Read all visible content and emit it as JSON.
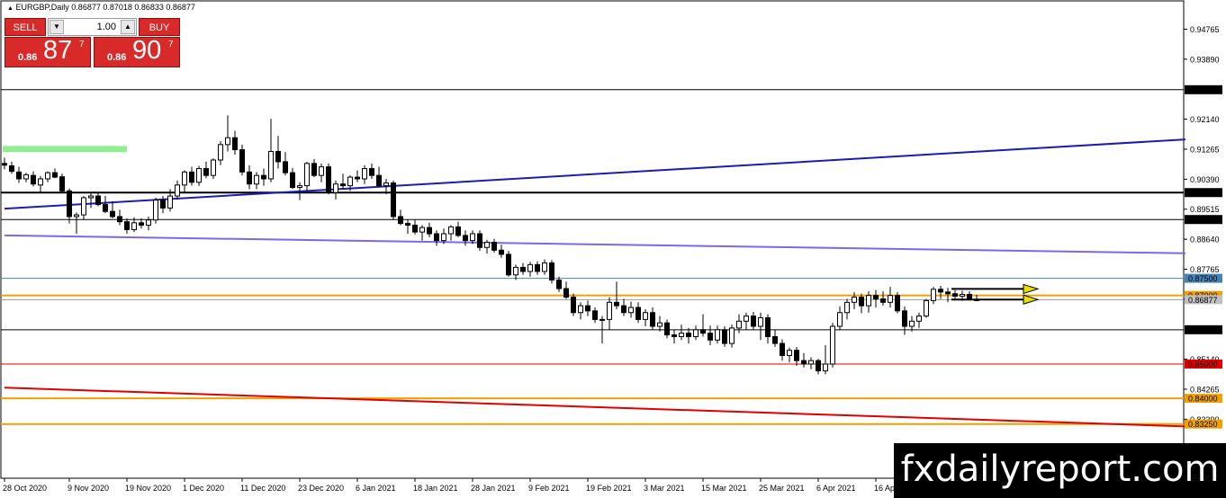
{
  "header": {
    "title": "EURGBP,Daily  0.86877 0.87018 0.86833 0.86877"
  },
  "trade_panel": {
    "sell_label": "SELL",
    "buy_label": "BUY",
    "lot_value": "1.00",
    "sell_price": {
      "small": "0.86",
      "big": "87",
      "sup": "7"
    },
    "buy_price": {
      "small": "0.86",
      "big": "90",
      "sup": "7"
    },
    "button_color": "#d92a2a"
  },
  "watermark": "fxdailyreport.com",
  "chart_data": {
    "type": "candlestick",
    "symbol": "EURGBP",
    "timeframe": "Daily",
    "ohlc_header": [
      0.86877,
      0.87018,
      0.86833,
      0.86877
    ],
    "ylim": [
      0.8167,
      0.9559
    ],
    "y_ticks": [
      "0.94765",
      "0.93890",
      "0.92140",
      "0.91265",
      "0.90390",
      "0.89515",
      "0.88640",
      "0.87765",
      "0.86890",
      "0.85140",
      "0.84265",
      "0.83390"
    ],
    "x_ticks": [
      "28 Oct 2020",
      "9 Nov 2020",
      "19 Nov 2020",
      "1 Dec 2020",
      "11 Dec 2020",
      "23 Dec 2020",
      "6 Jan 2021",
      "18 Jan 2021",
      "28 Jan 2021",
      "9 Feb 2021",
      "19 Feb 2021",
      "3 Mar 2021",
      "15 Mar 2021",
      "25 Mar 2021",
      "6 Apr 2021",
      "16 Apr"
    ],
    "x_tick_index": [
      0,
      9,
      17,
      25,
      33,
      41,
      49,
      57,
      65,
      73,
      81,
      89,
      97,
      105,
      113,
      121
    ],
    "horizontal_levels": [
      {
        "value": 0.93,
        "label": "0.93000",
        "color": "#000000"
      },
      {
        "value": 0.9,
        "label": "0.90000",
        "color": "#000000"
      },
      {
        "value": 0.89214,
        "label": "0.89214",
        "color": "#000000"
      },
      {
        "value": 0.875,
        "label": "0.87500",
        "color": "#4682b4"
      },
      {
        "value": 0.87,
        "label": "0.87000",
        "color": "#f0a000"
      },
      {
        "value": 0.86877,
        "label": "0.86877",
        "color": "#999999"
      },
      {
        "value": 0.86,
        "label": "0.86000",
        "color": "#000000"
      },
      {
        "value": 0.85,
        "label": "0.85000",
        "color": "#e00000"
      },
      {
        "value": 0.84,
        "label": "0.84000",
        "color": "#f0a000"
      },
      {
        "value": 0.8325,
        "label": "0.83250",
        "color": "#f0a000"
      }
    ],
    "trendlines": [
      {
        "color": "#1c1cb4",
        "start": [
          0,
          0.8953
        ],
        "end": [
          164,
          0.9155
        ]
      },
      {
        "color": "#7b68ee",
        "start": [
          0,
          0.8875
        ],
        "end": [
          164,
          0.8823
        ]
      },
      {
        "color": "#e00000",
        "start": [
          0,
          0.8431
        ],
        "end": [
          164,
          0.8318
        ]
      }
    ],
    "arrows": [
      {
        "color": "#e8e000",
        "start": [
          131.5,
          0.8719
        ],
        "end": [
          143.5,
          0.8719
        ]
      },
      {
        "color": "#e8e000",
        "start": [
          131.5,
          0.8688
        ],
        "end": [
          143.5,
          0.8688
        ]
      }
    ],
    "zone": {
      "color": "#90ee90",
      "x": [
        0,
        17
      ],
      "y": [
        0.9118,
        0.9136
      ]
    },
    "candles": [
      [
        0.9085,
        0.9102,
        0.9068,
        0.908
      ],
      [
        0.9078,
        0.909,
        0.9055,
        0.9062
      ],
      [
        0.906,
        0.9075,
        0.9028,
        0.904
      ],
      [
        0.904,
        0.9058,
        0.903,
        0.9052
      ],
      [
        0.905,
        0.9062,
        0.9018,
        0.9025
      ],
      [
        0.9022,
        0.9048,
        0.8998,
        0.904
      ],
      [
        0.904,
        0.9062,
        0.903,
        0.9058
      ],
      [
        0.9058,
        0.907,
        0.9042,
        0.9045
      ],
      [
        0.9046,
        0.9055,
        0.9,
        0.9005
      ],
      [
        0.9005,
        0.9012,
        0.891,
        0.893
      ],
      [
        0.893,
        0.8942,
        0.888,
        0.8935
      ],
      [
        0.8935,
        0.899,
        0.892,
        0.8985
      ],
      [
        0.8985,
        0.9,
        0.8955,
        0.899
      ],
      [
        0.899,
        0.9,
        0.896,
        0.8965
      ],
      [
        0.8965,
        0.899,
        0.894,
        0.8945
      ],
      [
        0.8945,
        0.8975,
        0.8925,
        0.893
      ],
      [
        0.893,
        0.895,
        0.8905,
        0.8915
      ],
      [
        0.8915,
        0.8925,
        0.888,
        0.8892
      ],
      [
        0.8892,
        0.8928,
        0.8885,
        0.8912
      ],
      [
        0.8912,
        0.8925,
        0.8895,
        0.8905
      ],
      [
        0.8905,
        0.893,
        0.889,
        0.892
      ],
      [
        0.892,
        0.8985,
        0.891,
        0.8978
      ],
      [
        0.8978,
        0.899,
        0.894,
        0.8955
      ],
      [
        0.8955,
        0.901,
        0.8945,
        0.899
      ],
      [
        0.899,
        0.9035,
        0.898,
        0.9022
      ],
      [
        0.9022,
        0.9065,
        0.9,
        0.906
      ],
      [
        0.906,
        0.9075,
        0.902,
        0.903
      ],
      [
        0.903,
        0.9078,
        0.902,
        0.907
      ],
      [
        0.907,
        0.909,
        0.9042,
        0.905
      ],
      [
        0.905,
        0.91,
        0.904,
        0.9095
      ],
      [
        0.9095,
        0.915,
        0.908,
        0.914
      ],
      [
        0.914,
        0.9225,
        0.912,
        0.916
      ],
      [
        0.916,
        0.918,
        0.911,
        0.9125
      ],
      [
        0.9125,
        0.914,
        0.905,
        0.906
      ],
      [
        0.906,
        0.908,
        0.901,
        0.9025
      ],
      [
        0.9025,
        0.906,
        0.901,
        0.905
      ],
      [
        0.905,
        0.907,
        0.902,
        0.904
      ],
      [
        0.904,
        0.9215,
        0.903,
        0.912
      ],
      [
        0.912,
        0.9165,
        0.907,
        0.909
      ],
      [
        0.909,
        0.9118,
        0.905,
        0.9058
      ],
      [
        0.9058,
        0.9072,
        0.901,
        0.9015
      ],
      [
        0.9015,
        0.903,
        0.8978,
        0.902
      ],
      [
        0.902,
        0.909,
        0.9005,
        0.9085
      ],
      [
        0.9085,
        0.9098,
        0.9045,
        0.905
      ],
      [
        0.905,
        0.9085,
        0.903,
        0.9075
      ],
      [
        0.9075,
        0.9085,
        0.8995,
        0.9
      ],
      [
        0.9,
        0.9035,
        0.898,
        0.9025
      ],
      [
        0.9025,
        0.9055,
        0.901,
        0.902
      ],
      [
        0.902,
        0.905,
        0.9005,
        0.9045
      ],
      [
        0.9045,
        0.9065,
        0.903,
        0.904
      ],
      [
        0.904,
        0.908,
        0.9025,
        0.907
      ],
      [
        0.907,
        0.9085,
        0.904,
        0.905
      ],
      [
        0.905,
        0.9075,
        0.9015,
        0.902
      ],
      [
        0.902,
        0.904,
        0.8995,
        0.9028
      ],
      [
        0.9028,
        0.9035,
        0.892,
        0.893
      ],
      [
        0.893,
        0.895,
        0.8905,
        0.891
      ],
      [
        0.891,
        0.8922,
        0.888,
        0.8905
      ],
      [
        0.8905,
        0.892,
        0.8878,
        0.8885
      ],
      [
        0.8885,
        0.8905,
        0.886,
        0.8898
      ],
      [
        0.8898,
        0.8912,
        0.887,
        0.888
      ],
      [
        0.888,
        0.889,
        0.8845,
        0.886
      ],
      [
        0.886,
        0.8895,
        0.885,
        0.888
      ],
      [
        0.888,
        0.8905,
        0.886,
        0.89
      ],
      [
        0.89,
        0.8915,
        0.887,
        0.8875
      ],
      [
        0.8875,
        0.889,
        0.8845,
        0.886
      ],
      [
        0.886,
        0.889,
        0.885,
        0.888
      ],
      [
        0.888,
        0.889,
        0.883,
        0.884
      ],
      [
        0.884,
        0.8862,
        0.8822,
        0.8855
      ],
      [
        0.8855,
        0.8865,
        0.8825,
        0.8832
      ],
      [
        0.8832,
        0.8848,
        0.881,
        0.882
      ],
      [
        0.882,
        0.883,
        0.8755,
        0.876
      ],
      [
        0.876,
        0.879,
        0.8745,
        0.8782
      ],
      [
        0.8782,
        0.8795,
        0.876,
        0.877
      ],
      [
        0.877,
        0.8798,
        0.8755,
        0.879
      ],
      [
        0.879,
        0.88,
        0.876,
        0.877
      ],
      [
        0.877,
        0.8805,
        0.876,
        0.8795
      ],
      [
        0.8795,
        0.8803,
        0.8735,
        0.8745
      ],
      [
        0.8745,
        0.8755,
        0.871,
        0.872
      ],
      [
        0.872,
        0.874,
        0.869,
        0.8695
      ],
      [
        0.8695,
        0.8705,
        0.864,
        0.865
      ],
      [
        0.865,
        0.868,
        0.863,
        0.867
      ],
      [
        0.867,
        0.8685,
        0.864,
        0.8655
      ],
      [
        0.8655,
        0.8665,
        0.862,
        0.863
      ],
      [
        0.863,
        0.864,
        0.856,
        0.863
      ],
      [
        0.863,
        0.8695,
        0.86,
        0.868
      ],
      [
        0.868,
        0.874,
        0.866,
        0.867
      ],
      [
        0.867,
        0.869,
        0.864,
        0.865
      ],
      [
        0.865,
        0.8682,
        0.8635,
        0.8665
      ],
      [
        0.8665,
        0.868,
        0.862,
        0.863
      ],
      [
        0.863,
        0.866,
        0.861,
        0.865
      ],
      [
        0.865,
        0.8665,
        0.86,
        0.861
      ],
      [
        0.861,
        0.864,
        0.8595,
        0.862
      ],
      [
        0.862,
        0.863,
        0.8575,
        0.8585
      ],
      [
        0.8585,
        0.86,
        0.856,
        0.858
      ],
      [
        0.858,
        0.8615,
        0.857,
        0.859
      ],
      [
        0.859,
        0.8605,
        0.856,
        0.858
      ],
      [
        0.858,
        0.8612,
        0.857,
        0.86
      ],
      [
        0.86,
        0.8645,
        0.858,
        0.859
      ],
      [
        0.859,
        0.8612,
        0.8555,
        0.857
      ],
      [
        0.857,
        0.8612,
        0.856,
        0.86
      ],
      [
        0.86,
        0.861,
        0.855,
        0.856
      ],
      [
        0.856,
        0.8615,
        0.8548,
        0.8605
      ],
      [
        0.8605,
        0.8645,
        0.859,
        0.8625
      ],
      [
        0.8625,
        0.865,
        0.86,
        0.864
      ],
      [
        0.864,
        0.8652,
        0.86,
        0.861
      ],
      [
        0.861,
        0.865,
        0.857,
        0.8635
      ],
      [
        0.8635,
        0.8645,
        0.856,
        0.858
      ],
      [
        0.858,
        0.86,
        0.855,
        0.856
      ],
      [
        0.856,
        0.8572,
        0.851,
        0.8525
      ],
      [
        0.8525,
        0.8548,
        0.8505,
        0.854
      ],
      [
        0.854,
        0.855,
        0.8495,
        0.851
      ],
      [
        0.851,
        0.8532,
        0.849,
        0.85
      ],
      [
        0.85,
        0.852,
        0.8485,
        0.851
      ],
      [
        0.851,
        0.8515,
        0.847,
        0.848
      ],
      [
        0.848,
        0.8555,
        0.847,
        0.85
      ],
      [
        0.85,
        0.862,
        0.849,
        0.861
      ],
      [
        0.861,
        0.8668,
        0.86,
        0.865
      ],
      [
        0.865,
        0.869,
        0.863,
        0.868
      ],
      [
        0.868,
        0.871,
        0.866,
        0.8695
      ],
      [
        0.8695,
        0.8705,
        0.8648,
        0.867
      ],
      [
        0.867,
        0.8712,
        0.865,
        0.87
      ],
      [
        0.87,
        0.8716,
        0.8665,
        0.869
      ],
      [
        0.869,
        0.8712,
        0.867,
        0.868
      ],
      [
        0.868,
        0.8725,
        0.8665,
        0.87
      ],
      [
        0.87,
        0.871,
        0.8648,
        0.8655
      ],
      [
        0.8655,
        0.8668,
        0.8585,
        0.861
      ],
      [
        0.861,
        0.864,
        0.8595,
        0.8625
      ],
      [
        0.8625,
        0.865,
        0.8605,
        0.864
      ],
      [
        0.864,
        0.869,
        0.8635,
        0.8685
      ],
      [
        0.8685,
        0.8725,
        0.8675,
        0.8718
      ],
      [
        0.8718,
        0.8728,
        0.869,
        0.871
      ],
      [
        0.871,
        0.8722,
        0.868,
        0.8705
      ],
      [
        0.8705,
        0.8716,
        0.8685,
        0.8698
      ],
      [
        0.8698,
        0.8714,
        0.8684,
        0.8703
      ],
      [
        0.8703,
        0.8712,
        0.8685,
        0.869
      ],
      [
        0.86877,
        0.87018,
        0.86833,
        0.86877
      ]
    ]
  }
}
